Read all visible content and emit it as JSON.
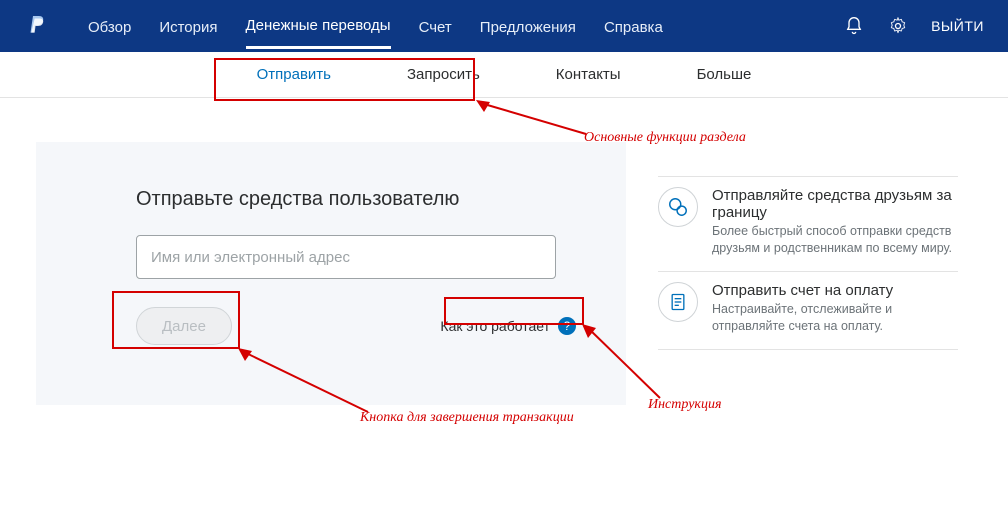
{
  "topbar": {
    "nav": {
      "overview": "Обзор",
      "history": "История",
      "transfers": "Денежные переводы",
      "account": "Счет",
      "offers": "Предложения",
      "help": "Справка"
    },
    "logout": "ВЫЙТИ"
  },
  "subtabs": {
    "send": "Отправить",
    "request": "Запросить",
    "contacts": "Контакты",
    "more": "Больше"
  },
  "panel": {
    "title": "Отправьте средства пользователю",
    "recipient_placeholder": "Имя или электронный адрес",
    "next_label": "Далее",
    "how_label": "Как это работает"
  },
  "info": {
    "abroad": {
      "title": "Отправляйте средства друзьям за границу",
      "body": "Более быстрый способ отправки средств друзьям и родственникам по всему миру."
    },
    "invoice": {
      "title": "Отправить счет на оплату",
      "body": "Настраивайте, отслеживайте и отправляйте счета на оплату."
    }
  },
  "annotations": {
    "main_functions": "Основные функции раздела",
    "instruction": "Инструкция",
    "finish_button": "Кнопка для завершения транзакции"
  }
}
